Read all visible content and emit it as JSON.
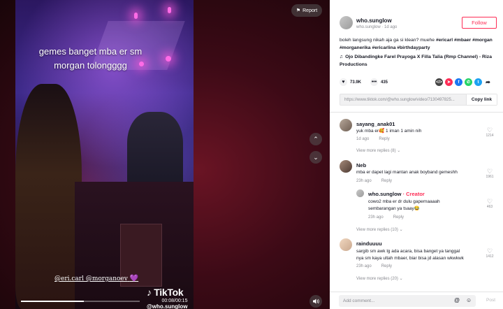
{
  "video": {
    "caption_line1": "gemes banget mba er sm",
    "caption_line2": "morgan tolongggg",
    "mentions": "@eri.carl @morganoev",
    "heart": "💜",
    "watermark_logo": "TikTok",
    "timestamp": "00:08/00:15",
    "watermark_user": "@who.sunglow",
    "progress_fraction": 0.53,
    "report_label": "Report"
  },
  "author": {
    "name": "who.sunglow",
    "subline": "who.sunglow · 1d ago",
    "follow_label": "Follow"
  },
  "post": {
    "description_plain": "boleh langsung nikah aja ga si klean? muehe",
    "hashtags": "#ericarl #mbaer #morgan #morganerika #ericarlina #birthdayparty",
    "music": "Ojo Dibandingke Farel Prayoga X Filla Talia (Rmp Channel) - Riza Productions",
    "likes": "73.9K",
    "comments": "435",
    "link": "https://www.tiktok.com/@who.sunglow/video/7130497825...",
    "copy_label": "Copy link"
  },
  "comments": [
    {
      "name": "sayang_anak01",
      "text": "yuk mba er🥰 1 iman 1 amin nih",
      "time": "1d ago",
      "reply": "Reply",
      "likes": "1214",
      "view_replies": "View more replies (8) ⌄"
    },
    {
      "name": "Neb",
      "text": "mba er dapet lagi mantan anak boyband gemeshh",
      "time": "23h ago",
      "reply": "Reply",
      "likes": "1961"
    },
    {
      "name": "who.sunglow",
      "creator_tag": "· Creator",
      "text_line1": "cowo2 mba er dr dulu gapernaaaah",
      "text_line2": "sembarangan ya tsaay😂",
      "time": "23h ago",
      "reply": "Reply",
      "likes": "463",
      "view_replies": "View more replies (10) ⌄"
    },
    {
      "name": "rainduuuu",
      "text_line1": "sargib sm awk lg ada acara, bisa banget ya tanggal",
      "text_line2": "nya sm kaya ultah mbaer, biar bisa jd alasan wkwkwk",
      "time": "23h ago",
      "reply": "Reply",
      "likes": "1412",
      "view_replies": "View more replies (20) ⌄"
    }
  ],
  "composer": {
    "placeholder": "Add comment...",
    "post_label": "Post"
  },
  "colors": {
    "accent": "#fe2c55",
    "text": "#161823",
    "muted": "#8a8b91"
  }
}
